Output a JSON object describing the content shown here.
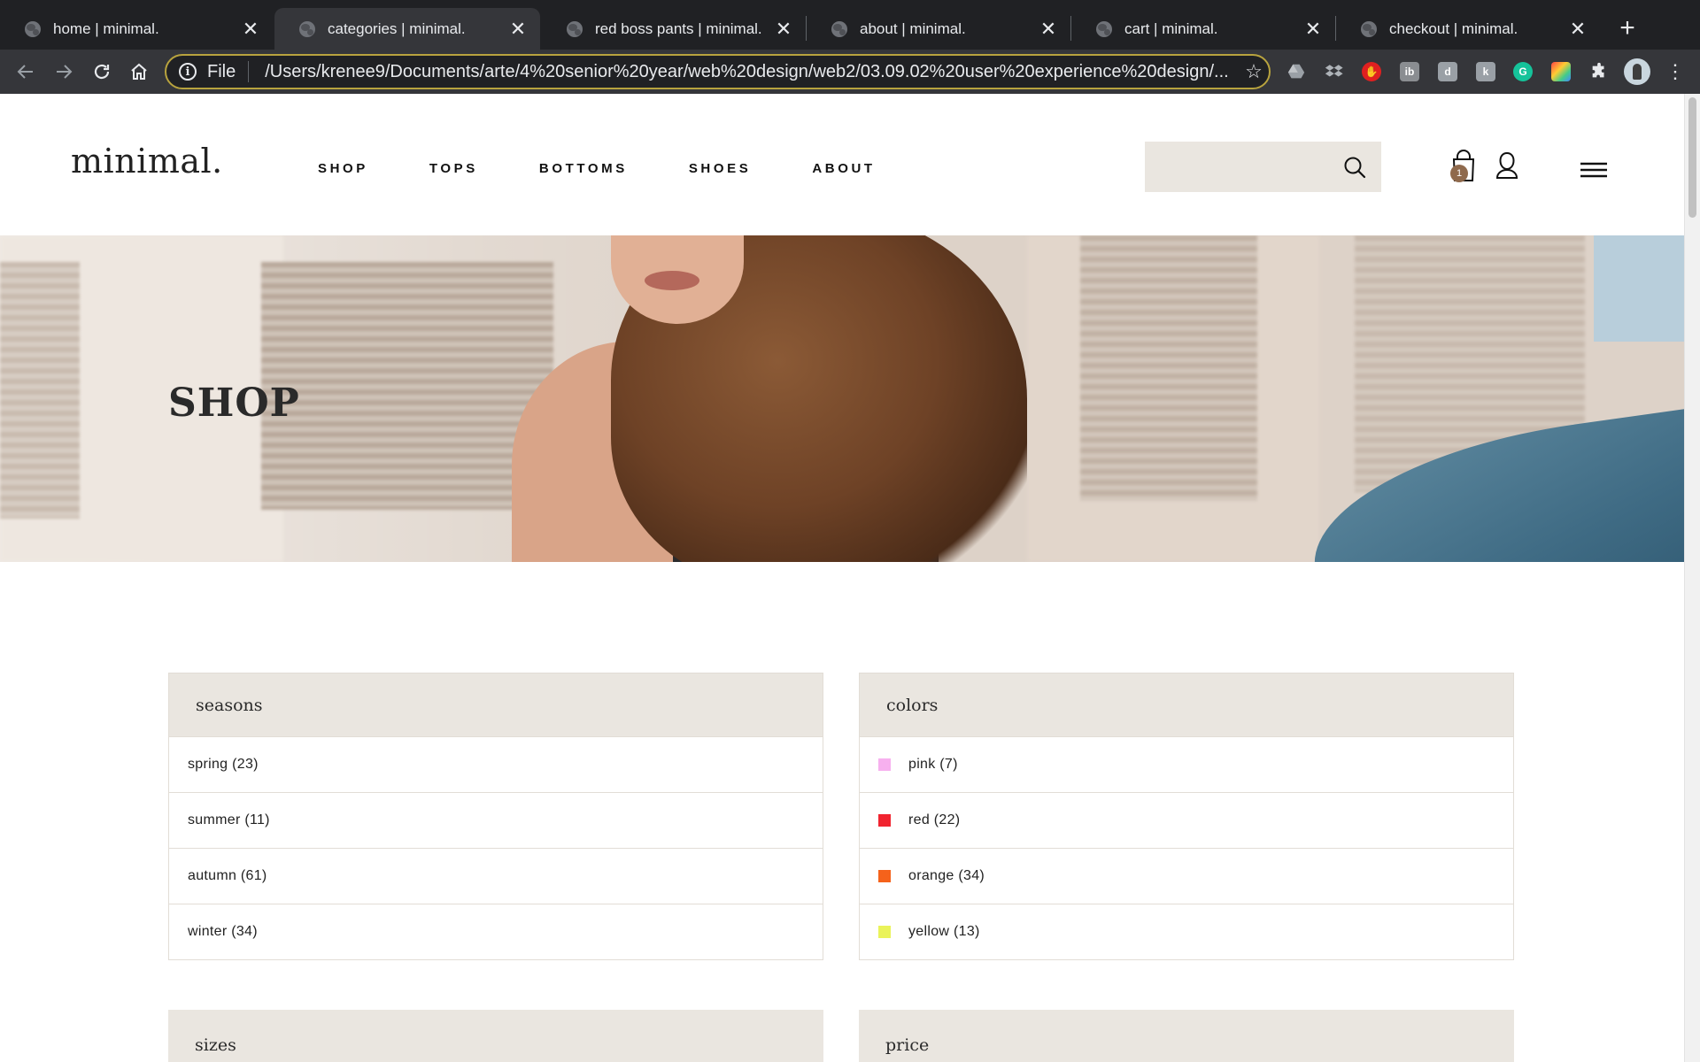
{
  "browser": {
    "tabs": [
      {
        "title": "home | minimal."
      },
      {
        "title": "categories | minimal.",
        "active": true
      },
      {
        "title": "red boss pants | minimal."
      },
      {
        "title": "about | minimal."
      },
      {
        "title": "cart | minimal."
      },
      {
        "title": "checkout | minimal."
      }
    ],
    "close_glyph": "✕",
    "new_tab_glyph": "+",
    "scheme": "File",
    "url": "/Users/krenee9/Documents/arte/4%20senior%20year/web%20design/web2/03.09.02%20user%20experience%20design/...",
    "extensions": [
      "drive-icon",
      "dropbox-icon",
      "adblock-icon",
      "ib-icon",
      "d-icon",
      "k-icon",
      "grammarly-icon",
      "palette-icon",
      "puzzle-icon"
    ]
  },
  "site": {
    "logo": "minimal.",
    "nav": [
      "SHOP",
      "TOPS",
      "BOTTOMS",
      "SHOES",
      "ABOUT"
    ],
    "search": {
      "value": "",
      "placeholder": ""
    },
    "cart_count": "1"
  },
  "hero": {
    "title": "SHOP"
  },
  "filters": {
    "seasons": {
      "title": "seasons",
      "options": [
        "spring (23)",
        "summer (11)",
        "autumn (61)",
        "winter (34)"
      ]
    },
    "colors": {
      "title": "colors",
      "options": [
        {
          "label": "pink (7)",
          "color": "#f7b0ef"
        },
        {
          "label": "red (22)",
          "color": "#f12430"
        },
        {
          "label": "orange (34)",
          "color": "#f5621b"
        },
        {
          "label": "yellow (13)",
          "color": "#eaf35a"
        }
      ]
    },
    "sizes": {
      "title": "sizes"
    },
    "price": {
      "title": "price"
    }
  },
  "colors": {
    "accent_bg": "#eae6e0",
    "badge": "#8f6a4d",
    "omnibox_border": "#b8a33e"
  }
}
